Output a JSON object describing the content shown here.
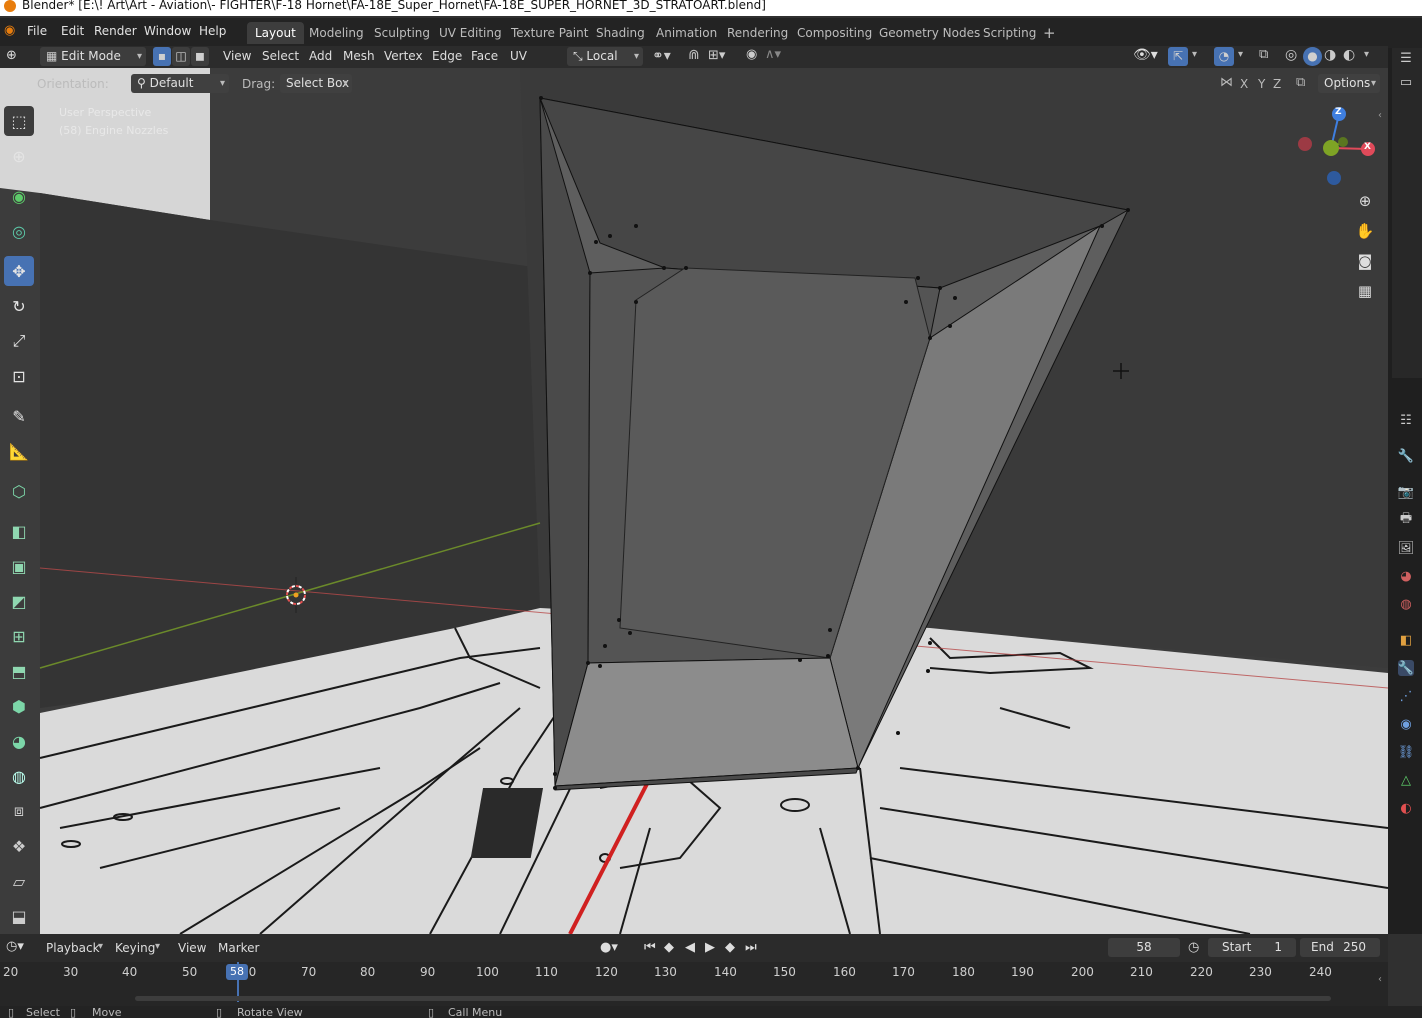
{
  "window": {
    "title": "Blender* [E:\\! Art\\Art - Aviation\\- FIGHTER\\F-18 Hornet\\FA-18E_Super_Hornet\\FA-18E_SUPER_HORNET_3D_STRATOART.blend]"
  },
  "menubar": {
    "items": [
      "File",
      "Edit",
      "Render",
      "Window",
      "Help"
    ],
    "workspaces": [
      "Layout",
      "Modeling",
      "Sculpting",
      "UV Editing",
      "Texture Paint",
      "Shading",
      "Animation",
      "Rendering",
      "Compositing",
      "Geometry Nodes",
      "Scripting"
    ],
    "active_workspace": "Layout",
    "add_tab": "+"
  },
  "header": {
    "mode": "Edit Mode",
    "menus": [
      "View",
      "Select",
      "Add",
      "Mesh",
      "Vertex",
      "Edge",
      "Face",
      "UV"
    ],
    "transform_space": "Local",
    "options": "Options"
  },
  "tool_settings": {
    "orientation_label": "Orientation:",
    "orientation_value": "Default",
    "drag_label": "Drag:",
    "drag_value": "Select Box",
    "axes": [
      "X",
      "Y",
      "Z"
    ]
  },
  "viewport": {
    "view_name": "User Perspective",
    "object_info": "(58) Engine Nozzles",
    "gizmo_axes": {
      "x": "X",
      "y": "Y",
      "z": "Z"
    },
    "colors": {
      "x_axis": "#e04a5a",
      "y_axis": "#7ea325",
      "z_axis": "#3f7fe0",
      "accent": "#4772b3"
    }
  },
  "tools": [
    "select-box",
    "cursor",
    "annotate-green",
    "origin",
    "move",
    "rotate",
    "scale",
    "transform",
    "annotate",
    "measure",
    "add-cube",
    "extrude",
    "inset",
    "bevel",
    "loop-cut",
    "knife",
    "poly-build",
    "spin",
    "smooth",
    "edge-slide",
    "shrink-fatten",
    "shear",
    "rip"
  ],
  "timeline": {
    "menus": [
      "Playback",
      "Keying",
      "View",
      "Marker"
    ],
    "current_frame": "58",
    "start_label": "Start",
    "start_value": "1",
    "end_label": "End",
    "end_value": "250",
    "ticks": [
      "20",
      "30",
      "40",
      "50",
      "60",
      "70",
      "80",
      "90",
      "100",
      "110",
      "120",
      "130",
      "140",
      "150",
      "160",
      "170",
      "180",
      "190",
      "200",
      "210",
      "220",
      "230",
      "240"
    ]
  },
  "statusbar": {
    "items": [
      "Select",
      "Move",
      "Rotate View",
      "Call Menu"
    ]
  }
}
